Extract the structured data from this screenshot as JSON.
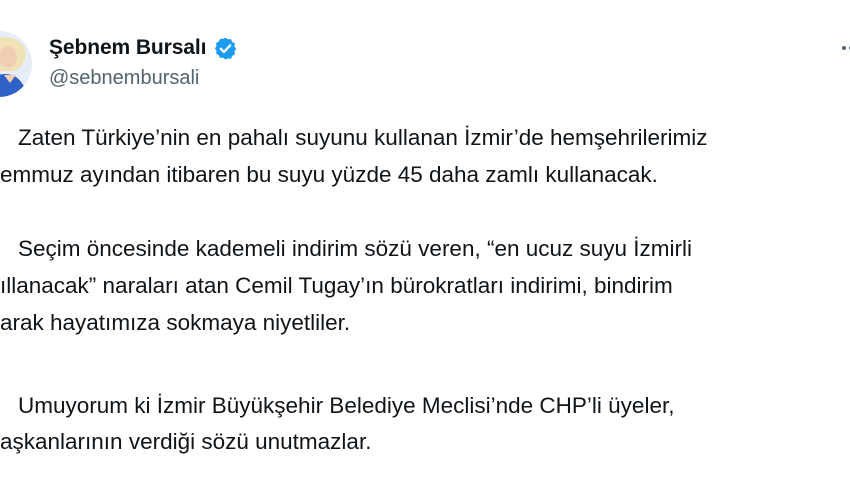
{
  "author": {
    "display_name": "Şebnem Bursalı",
    "handle": "@sebnembursali",
    "verified": true,
    "verified_color": "#1d9bf0",
    "avatar_icon": "user-avatar-icon"
  },
  "menu": {
    "icon": "more-options-icon"
  },
  "tweet": {
    "paragraphs": [
      {
        "lines": [
          "Zaten Türkiye’nin en pahalı suyunu kullanan İzmir’de hemşehrilerimiz",
          "emmuz ayından itibaren bu suyu yüzde 45 daha zamlı kullanacak."
        ]
      },
      {
        "lines": [
          "Seçim öncesinde kademeli indirim sözü veren, “en ucuz suyu İzmirli",
          "ıllanacak” naraları atan Cemil Tugay’ın bürokratları indirimi, bindirim",
          "arak hayatımıza sokmaya niyetliler."
        ]
      },
      {
        "lines": [
          "Umuyorum ki İzmir Büyükşehir Belediye Meclisi’nde CHP’li üyeler,",
          "aşkanlarının verdiği sözü unutmazlar."
        ]
      }
    ]
  }
}
